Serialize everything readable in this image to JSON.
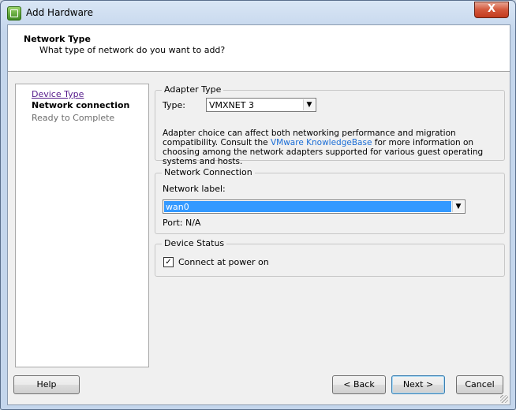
{
  "window": {
    "title": "Add Hardware",
    "close_label": "X"
  },
  "header": {
    "title": "Network Type",
    "subtitle": "What type of network do you want to add?"
  },
  "steps": [
    {
      "label": "Device Type",
      "state": "visited"
    },
    {
      "label": "Network connection",
      "state": "current"
    },
    {
      "label": "Ready to Complete",
      "state": "upcoming"
    }
  ],
  "adapter_type": {
    "legend": "Adapter Type",
    "type_label": "Type:",
    "type_value": "VMXNET 3",
    "desc_before": "Adapter choice can affect both networking performance and migration compatibility. Consult the ",
    "desc_link": "VMware KnowledgeBase",
    "desc_after": " for more information on choosing among the network adapters supported for various guest operating systems and hosts."
  },
  "network_connection": {
    "legend": "Network Connection",
    "label_caption": "Network label:",
    "label_value": "wan0",
    "port_label": "Port:",
    "port_value": "N/A"
  },
  "device_status": {
    "legend": "Device Status",
    "connect_label": "Connect at power on",
    "connect_checked": true,
    "check_mark": "✓"
  },
  "footer": {
    "help_label": "Help",
    "back_label": "< Back",
    "next_label": "Next >",
    "cancel_label": "Cancel"
  }
}
